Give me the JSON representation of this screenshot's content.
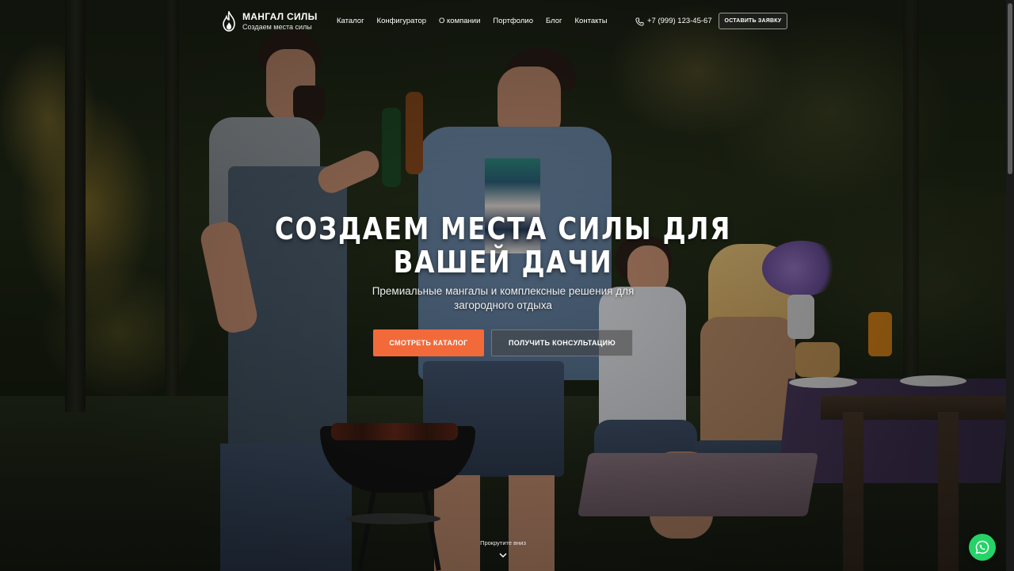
{
  "header": {
    "logo_title": "МАНГАЛ СИЛЫ",
    "logo_subtitle": "Создаем места силы",
    "logo_icon": "flame-icon",
    "nav": [
      {
        "label": "Каталог"
      },
      {
        "label": "Конфигуратор"
      },
      {
        "label": "О компании"
      },
      {
        "label": "Портфолио"
      },
      {
        "label": "Блог"
      },
      {
        "label": "Контакты"
      }
    ],
    "phone": "+7 (999) 123-45-67",
    "phone_icon": "phone-icon",
    "cta_label": "ОСТАВИТЬ ЗАЯВКУ"
  },
  "hero": {
    "title": "СОЗДАЕМ МЕСТА СИЛЫ ДЛЯ ВАШЕЙ ДАЧИ",
    "subtitle": "Премиальные мангалы и комплексные решения для загородного отдыха",
    "primary_button": "СМОТРЕТЬ КАТАЛОГ",
    "secondary_button": "ПОЛУЧИТЬ КОНСУЛЬТАЦИЮ",
    "scroll_hint": "Прокрутите вниз",
    "scroll_icon": "chevron-down-icon"
  },
  "floating": {
    "whatsapp_icon": "whatsapp-icon"
  },
  "colors": {
    "accent": "#f26a3a",
    "whatsapp": "#25d366"
  }
}
